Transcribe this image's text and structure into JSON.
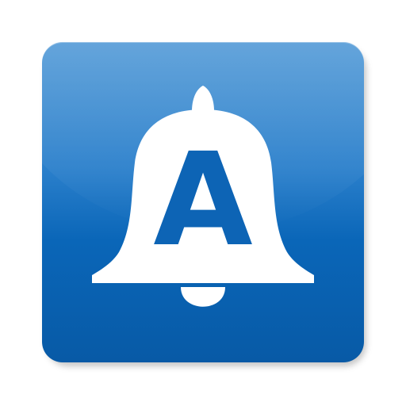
{
  "app_icon": {
    "icon_name": "bell-icon",
    "letter": "A",
    "colors": {
      "tile_top": "#4f98d6",
      "tile_bottom": "#085aa6",
      "bell": "#ffffff",
      "letter": "#0d64b5"
    }
  }
}
